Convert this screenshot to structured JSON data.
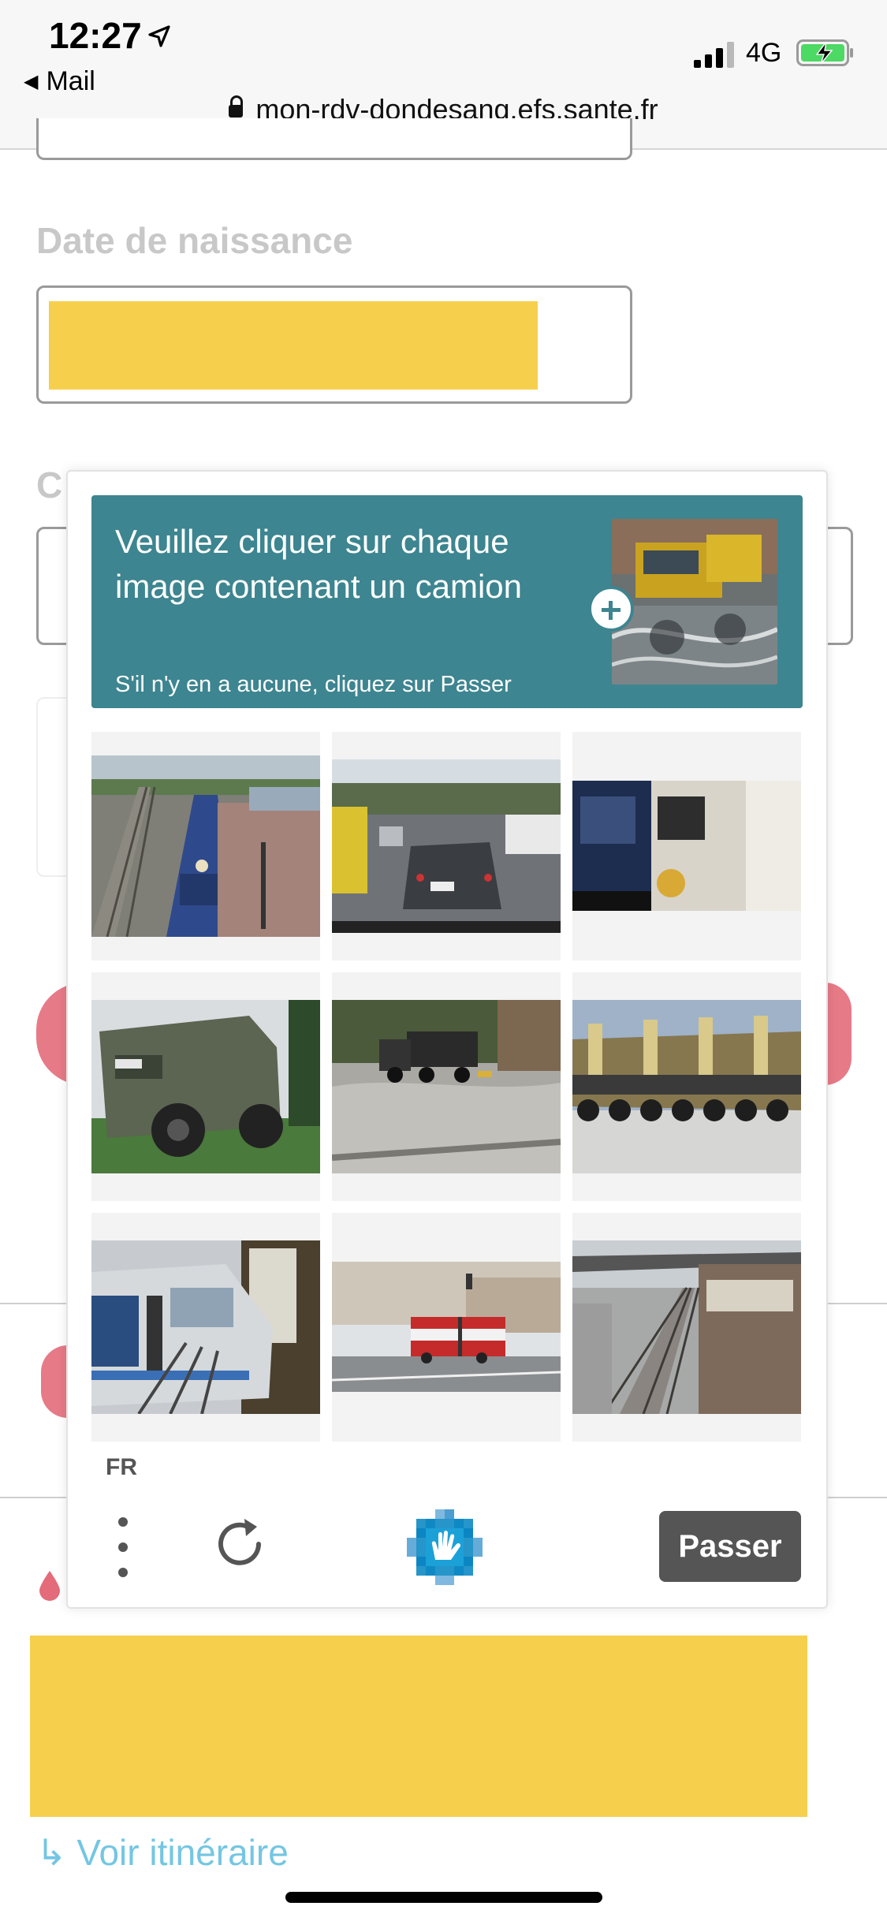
{
  "status_bar": {
    "time": "12:27",
    "back_app": "Mail",
    "network": "4G",
    "url": "mon-rdv-dondesang.efs.sante.fr"
  },
  "form": {
    "birth_label": "Date de naissance",
    "partial_label_letter": "C",
    "route_link": "Voir itinéraire"
  },
  "captcha": {
    "prompt_main": "Veuillez cliquer sur chaque image contenant un camion",
    "prompt_sub": "S'il n'y en a aucune, cliquez sur Passer",
    "language": "FR",
    "skip_label": "Passer",
    "accent_color": "#3d8590",
    "tiles": [
      {
        "subject": "blue locomotive at a station platform"
      },
      {
        "subject": "car in traffic, rear view"
      },
      {
        "subject": "fire truck cab with driver"
      },
      {
        "subject": "armored military vehicle"
      },
      {
        "subject": "dump truck on a muddy field"
      },
      {
        "subject": "long flatbed trailer with many wheels"
      },
      {
        "subject": "commuter train at a platform"
      },
      {
        "subject": "articulated red and white bus on a street"
      },
      {
        "subject": "railway tracks with a train"
      }
    ]
  }
}
